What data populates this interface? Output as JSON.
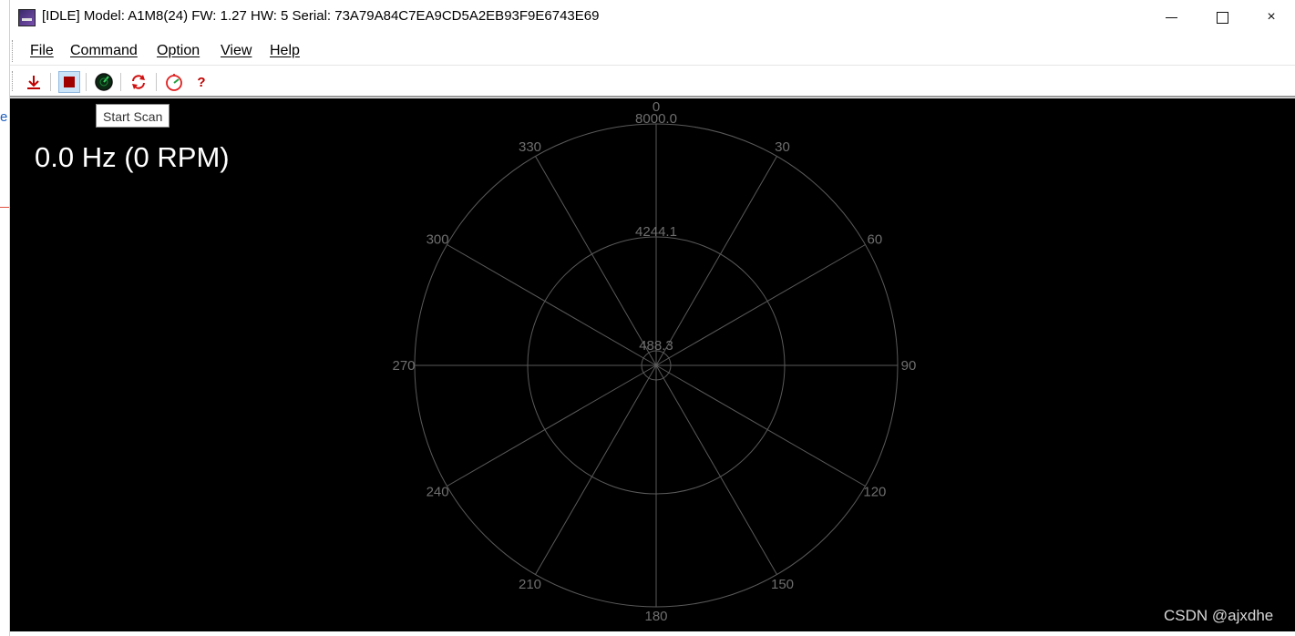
{
  "window": {
    "title": "[IDLE] Model: A1M8(24) FW: 1.27 HW: 5 Serial: 73A79A84C7EA9CD5A2EB93F9E6743E69",
    "controls": {
      "minimize": "minimize",
      "maximize": "maximize",
      "close": "×"
    }
  },
  "background_fragment": "e",
  "menu": {
    "items": [
      {
        "key": "file",
        "label": "File"
      },
      {
        "key": "command",
        "label": "Command"
      },
      {
        "key": "option",
        "label": "Option"
      },
      {
        "key": "view",
        "label": "View"
      },
      {
        "key": "help",
        "label": "Help"
      }
    ]
  },
  "toolbar": {
    "buttons": [
      {
        "key": "download",
        "icon": "download-icon"
      },
      {
        "key": "stop",
        "icon": "stop-icon",
        "active": true
      },
      {
        "key": "scan",
        "icon": "radar-scan-icon"
      },
      {
        "key": "reset",
        "icon": "refresh-icon"
      },
      {
        "key": "motor",
        "icon": "motor-speed-icon"
      },
      {
        "key": "help",
        "icon": "help-icon",
        "label": "?"
      }
    ],
    "tooltip": "Start Scan"
  },
  "scan": {
    "frequency_text": "0.0 Hz (0 RPM)",
    "rings": [
      "8000.0",
      "4244.1",
      "488.3"
    ],
    "angles": [
      "0",
      "30",
      "60",
      "90",
      "120",
      "150",
      "180",
      "210",
      "240",
      "270",
      "300",
      "330"
    ],
    "colors": {
      "background": "#000000",
      "grid": "#5a5a5a",
      "text": "#ffffff"
    }
  },
  "watermark": "CSDN @ajxdhe"
}
